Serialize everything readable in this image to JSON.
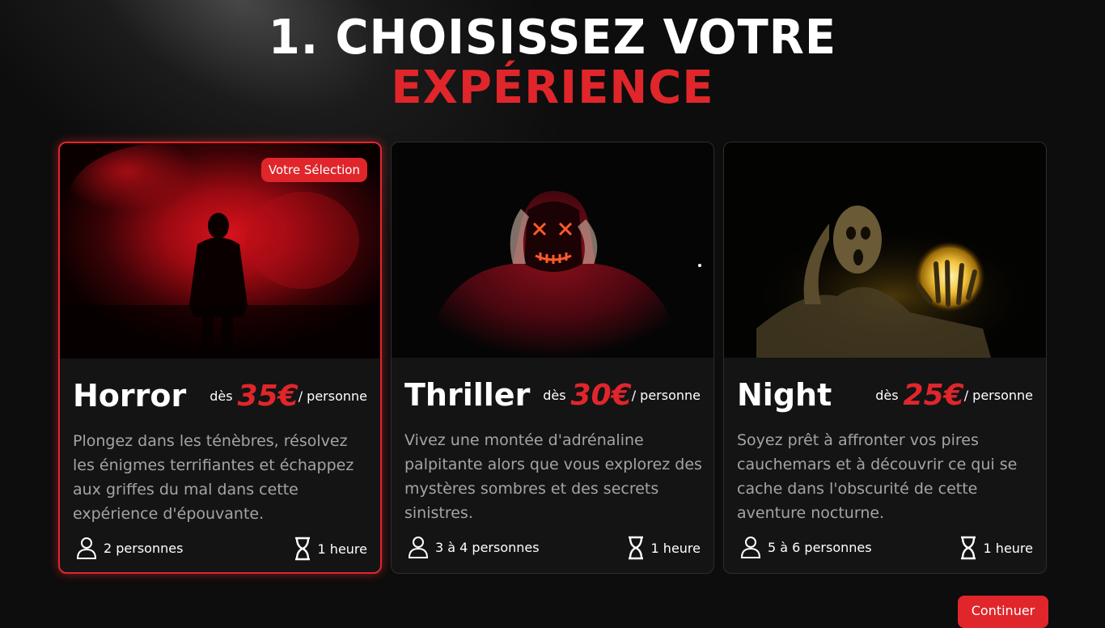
{
  "heading": {
    "line1": "1. Choisissez votre",
    "line2": "expérience"
  },
  "colors": {
    "accent": "#e0262b",
    "background": "#0d0d0d",
    "card": "#141414"
  },
  "cards": [
    {
      "name": "Horror",
      "price_prefix": "dès",
      "price": "35€",
      "price_suffix": "/ personne",
      "description": "Plongez dans les ténèbres, résolvez les énigmes terrifiantes et échappez aux griffes du mal dans cette expérience d'épouvante.",
      "players": "2 personnes",
      "duration": "1 heure",
      "badge": "Votre Sélection",
      "selected": true
    },
    {
      "name": "Thriller",
      "price_prefix": "dès",
      "price": "30€",
      "price_suffix": "/ personne",
      "description": "Vivez une montée d'adrénaline palpitante alors que vous explorez des mystères sombres et des secrets sinistres.",
      "players": "3 à 4 personnes",
      "duration": "1 heure",
      "selected": false
    },
    {
      "name": "Night",
      "price_prefix": "dès",
      "price": "25€",
      "price_suffix": "/ personne",
      "description": "Soyez prêt à affronter vos pires cauchemars et à découvrir ce qui se cache dans l'obscurité de cette aventure nocturne.",
      "players": "5 à 6 personnes",
      "duration": "1 heure",
      "selected": false
    }
  ],
  "continue_label": "Continuer"
}
